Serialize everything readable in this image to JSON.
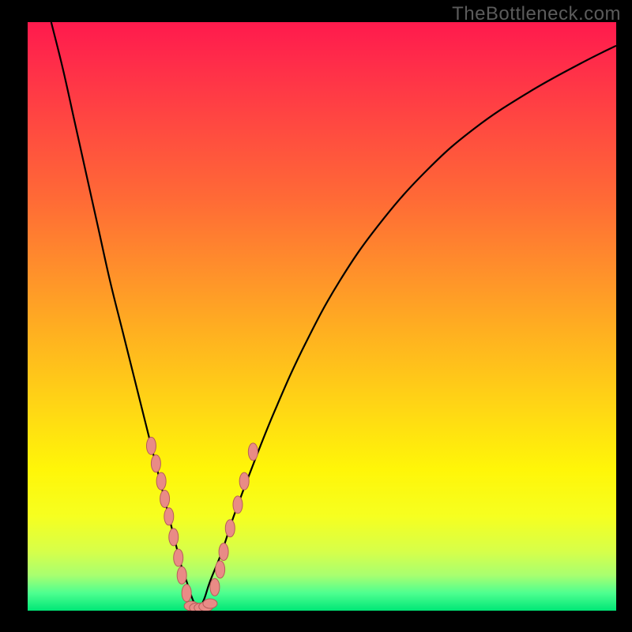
{
  "watermark": "TheBottleneck.com",
  "colors": {
    "bg": "#000000",
    "curve": "#000000",
    "marker_fill": "#e98b86",
    "marker_stroke": "#b65d59",
    "gradient_top": "#ff1a4d",
    "gradient_mid": "#ffd814",
    "gradient_bottom": "#00e676"
  },
  "chart_data": {
    "type": "line",
    "title": "",
    "xlabel": "",
    "ylabel": "",
    "xlim": [
      0,
      100
    ],
    "ylim": [
      0,
      100
    ],
    "series": [
      {
        "name": "left-curve",
        "x": [
          4,
          6,
          8,
          10,
          12,
          14,
          16,
          18,
          20,
          22,
          24,
          25,
          26,
          27,
          28,
          29
        ],
        "y": [
          100,
          92,
          83,
          74,
          65,
          56,
          48,
          40,
          32,
          24,
          16,
          12,
          8,
          5,
          2,
          0
        ]
      },
      {
        "name": "right-curve",
        "x": [
          29,
          30,
          31,
          33,
          35,
          38,
          42,
          47,
          53,
          60,
          68,
          76,
          85,
          94,
          100
        ],
        "y": [
          0,
          2,
          5,
          10,
          16,
          24,
          34,
          45,
          56,
          66,
          75,
          82,
          88,
          93,
          96
        ]
      },
      {
        "name": "left-markers",
        "x": [
          21.0,
          21.8,
          22.7,
          23.3,
          24.0,
          24.8,
          25.6,
          26.2,
          27.0
        ],
        "y": [
          28.0,
          25.0,
          22.0,
          19.0,
          16.0,
          12.5,
          9.0,
          6.0,
          3.0
        ]
      },
      {
        "name": "valley-markers",
        "x": [
          27.8,
          28.7,
          29.5,
          30.3,
          31.0
        ],
        "y": [
          0.8,
          0.5,
          0.5,
          0.7,
          1.2
        ]
      },
      {
        "name": "right-markers",
        "x": [
          31.8,
          32.7,
          33.3,
          34.4,
          35.7,
          36.8,
          38.3
        ],
        "y": [
          4.0,
          7.0,
          10.0,
          14.0,
          18.0,
          22.0,
          27.0
        ]
      }
    ]
  }
}
